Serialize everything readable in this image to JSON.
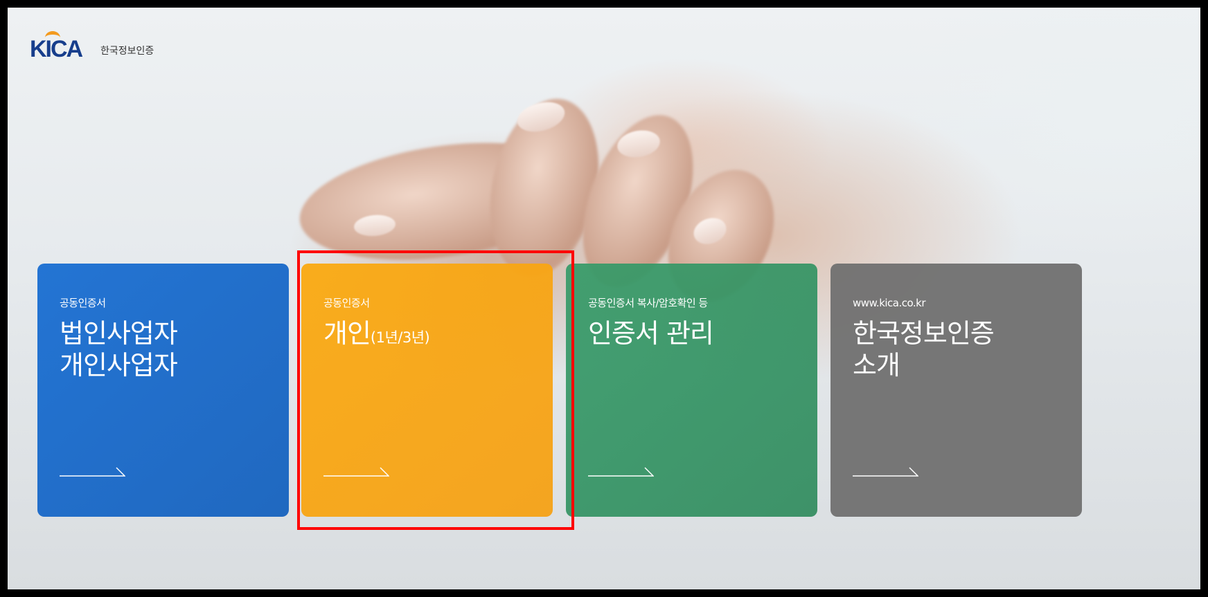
{
  "logo": {
    "mark": "KICA",
    "company": "한국정보인증"
  },
  "cards": [
    {
      "sub": "공동인증서",
      "title_line1": "법인사업자",
      "title_line2": "개인사업자",
      "color": "#1a6ed2"
    },
    {
      "sub": "공동인증서",
      "title_main": "개인",
      "title_suffix": "(1년/3년)",
      "color": "#f9a816"
    },
    {
      "sub": "공동인증서 복사/암호확인 등",
      "title": "인증서 관리",
      "color": "#379b69"
    },
    {
      "sub": "www.kica.co.kr",
      "title_line1": "한국정보인증",
      "title_line2": "소개",
      "color": "#707070"
    }
  ],
  "icons": {
    "card_arrow": "arrow-right-icon"
  },
  "highlight_color": "#ff0000"
}
